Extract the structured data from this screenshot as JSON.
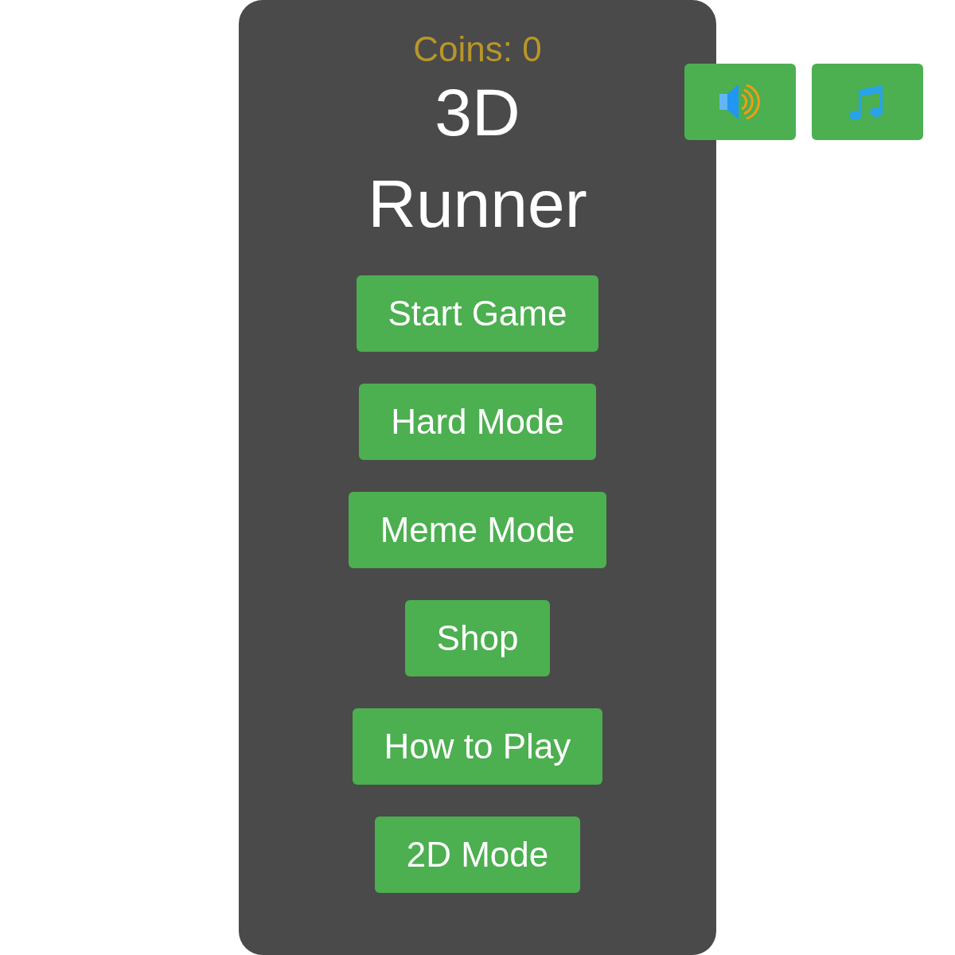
{
  "coins": "Coins: 0",
  "title": "3D Runner",
  "menu_buttons": [
    "Start Game",
    "Hard Mode",
    "Meme Mode",
    "Shop",
    "How to Play",
    "2D Mode"
  ],
  "audio_buttons": [
    {
      "kind": "sound"
    },
    {
      "kind": "music"
    }
  ]
}
